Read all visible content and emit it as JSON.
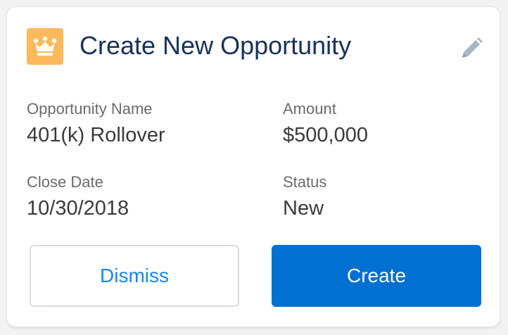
{
  "header": {
    "title": "Create New Opportunity",
    "icon": "crown-icon",
    "icon_color": "#fcb95b",
    "edit_icon": "pencil-icon"
  },
  "fields": {
    "opportunity_name": {
      "label": "Opportunity Name",
      "value": "401(k) Rollover"
    },
    "amount": {
      "label": "Amount",
      "value": "$500,000"
    },
    "close_date": {
      "label": "Close Date",
      "value": "10/30/2018"
    },
    "status": {
      "label": "Status",
      "value": "New"
    }
  },
  "actions": {
    "dismiss_label": "Dismiss",
    "create_label": "Create",
    "primary_color": "#0070d2"
  }
}
